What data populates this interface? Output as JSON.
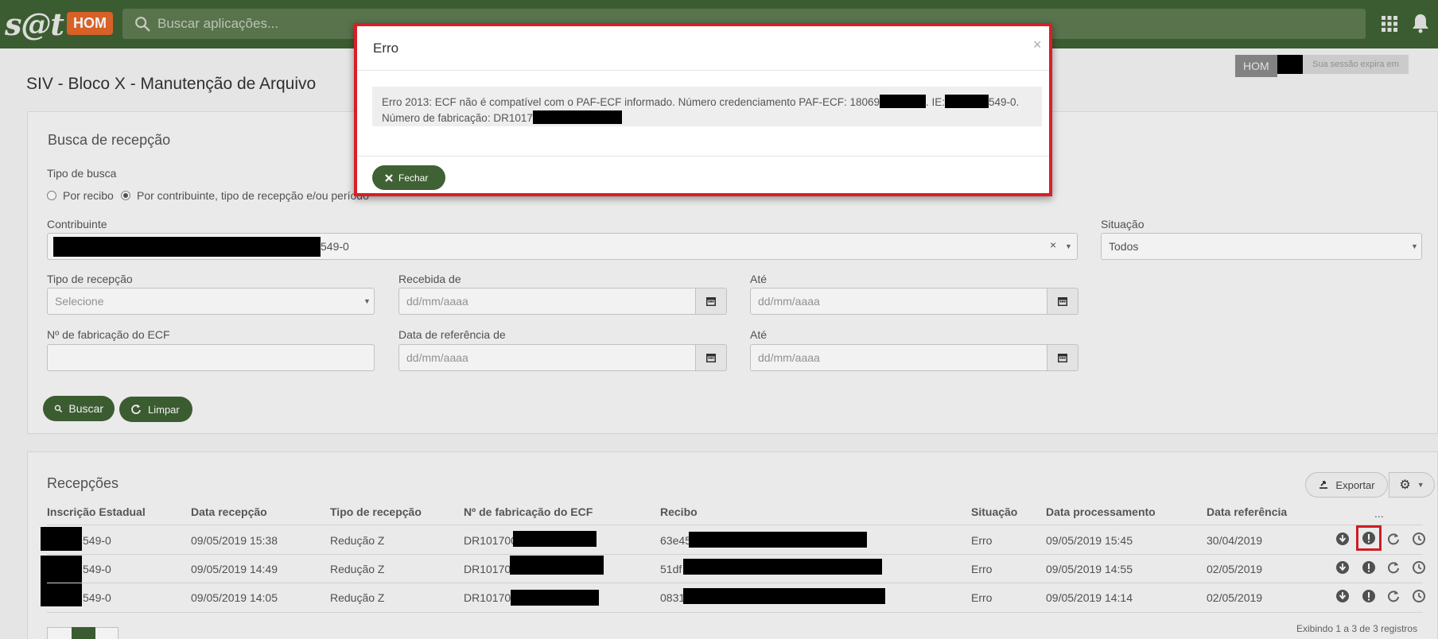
{
  "header": {
    "logo": "s@t",
    "env_badge": "HOM",
    "search_placeholder": "Buscar aplicações..."
  },
  "session": {
    "label": "HOM",
    "expires_text": "Sua sessão expira em"
  },
  "page": {
    "title": "SIV - Bloco X - Manutenção de Arquivo"
  },
  "search_form": {
    "title": "Busca de recepção",
    "tipo_busca_label": "Tipo de busca",
    "radio_recibo": "Por recibo",
    "radio_contribuinte": "Por contribuinte, tipo de recepção e/ou período",
    "contribuinte_label": "Contribuinte",
    "contribuinte_value_suffix": "549-0",
    "situacao_label": "Situação",
    "situacao_value": "Todos",
    "tipo_recepcao_label": "Tipo de recepção",
    "tipo_recepcao_placeholder": "Selecione",
    "recebida_de_label": "Recebida de",
    "ate_label": "Até",
    "date_placeholder": "dd/mm/aaaa",
    "fabricacao_label": "Nº de fabricação do ECF",
    "data_referencia_label": "Data de referência de",
    "buscar_label": "Buscar",
    "limpar_label": "Limpar"
  },
  "results": {
    "title": "Recepções",
    "exportar_label": "Exportar",
    "columns": [
      "Inscrição Estadual",
      "Data recepção",
      "Tipo de recepção",
      "Nº de fabricação do ECF",
      "Recibo",
      "Situação",
      "Data processamento",
      "Data referência",
      "..."
    ],
    "rows": [
      {
        "ie": "549-0",
        "data_recepcao": "09/05/2019 15:38",
        "tipo": "Redução Z",
        "fabricacao": "DR101700",
        "recibo": "63e45",
        "situacao": "Erro",
        "data_processamento": "09/05/2019 15:45",
        "data_referencia": "30/04/2019"
      },
      {
        "ie": "549-0",
        "data_recepcao": "09/05/2019 14:49",
        "tipo": "Redução Z",
        "fabricacao": "DR10170",
        "recibo": "51df",
        "situacao": "Erro",
        "data_processamento": "09/05/2019 14:55",
        "data_referencia": "02/05/2019"
      },
      {
        "ie": "549-0",
        "data_recepcao": "09/05/2019 14:05",
        "tipo": "Redução Z",
        "fabricacao": "DR10170",
        "recibo": "0831",
        "situacao": "Erro",
        "data_processamento": "09/05/2019 14:14",
        "data_referencia": "02/05/2019"
      }
    ],
    "footer": "Exibindo 1 a 3 de 3 registros"
  },
  "modal": {
    "title": "Erro",
    "close_glyph": "×",
    "message_part1": "Erro 2013: ECF não é compatível com o PAF-ECF informado. Número credenciamento PAF-ECF: 18069",
    "message_part2": ". IE:",
    "message_part3": "549-0.",
    "message_line2": "Número de fabricação: DR1017",
    "fechar_label": "Fechar"
  },
  "colors": {
    "header_green": "#3f6133",
    "badge_orange": "#e3672a",
    "highlight_red": "#d81f26"
  }
}
